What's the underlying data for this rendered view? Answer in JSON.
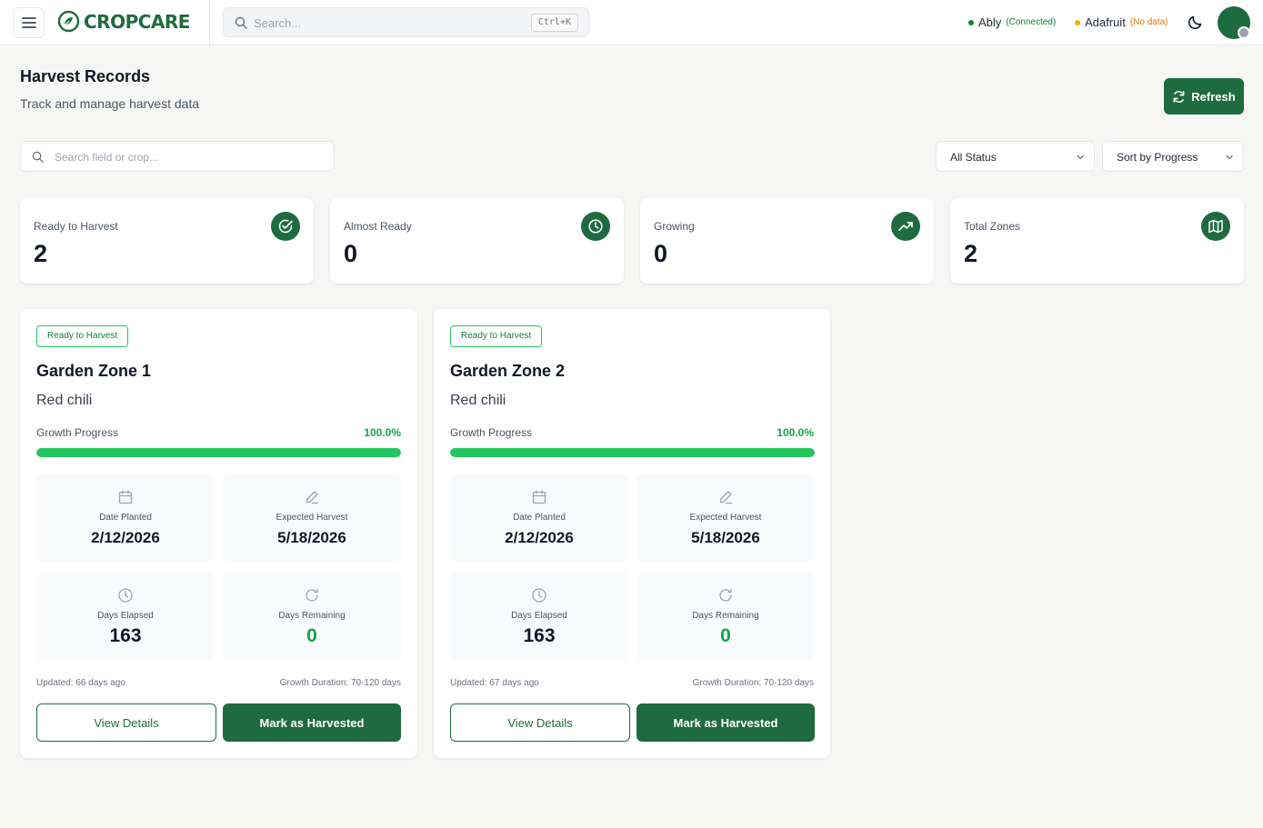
{
  "app": {
    "name": "CROPCARE"
  },
  "topbar": {
    "search_placeholder": "Search...",
    "shortcut": "Ctrl+K",
    "connections": [
      {
        "name": "Ably",
        "state": "(Connected)",
        "color": "#15803d"
      },
      {
        "name": "Adafruit",
        "state": "(No data)",
        "color": "#d97706"
      }
    ]
  },
  "header": {
    "title": "Harvest Records",
    "subtitle": "Track and manage harvest data",
    "refresh_label": "Refresh"
  },
  "filters": {
    "search_placeholder": "Search field or crop...",
    "status_value": "All Status",
    "sort_value": "Sort by Progress"
  },
  "stats": [
    {
      "label": "Ready to Harvest",
      "value": "2",
      "icon": "check-circle-icon"
    },
    {
      "label": "Almost Ready",
      "value": "0",
      "icon": "clock-icon"
    },
    {
      "label": "Growing",
      "value": "0",
      "icon": "trending-up-icon"
    },
    {
      "label": "Total Zones",
      "value": "2",
      "icon": "map-icon"
    }
  ],
  "zones": [
    {
      "status": "Ready to Harvest",
      "name": "Garden Zone 1",
      "crop": "Red chili",
      "progress_label": "Growth Progress",
      "progress_text": "100.0%",
      "progress": 1.0,
      "date_planted_label": "Date Planted",
      "date_planted": "2/12/2026",
      "expected_harvest_label": "Expected Harvest",
      "expected_harvest": "5/18/2026",
      "days_elapsed_label": "Days Elapsed",
      "days_elapsed": "163",
      "days_remaining_label": "Days Remaining",
      "days_remaining": "0",
      "updated": "Updated: 66 days ago",
      "duration": "Growth Duration: 70-120 days",
      "view_label": "View Details",
      "harvest_label": "Mark as Harvested"
    },
    {
      "status": "Ready to Harvest",
      "name": "Garden Zone 2",
      "crop": "Red chili",
      "progress_label": "Growth Progress",
      "progress_text": "100.0%",
      "progress": 1.0,
      "date_planted_label": "Date Planted",
      "date_planted": "2/12/2026",
      "expected_harvest_label": "Expected Harvest",
      "expected_harvest": "5/18/2026",
      "days_elapsed_label": "Days Elapsed",
      "days_elapsed": "163",
      "days_remaining_label": "Days Remaining",
      "days_remaining": "0",
      "updated": "Updated: 67 days ago",
      "duration": "Growth Duration: 70-120 days",
      "view_label": "View Details",
      "harvest_label": "Mark as Harvested"
    }
  ],
  "colors": {
    "brand": "#1f6b40",
    "success": "#22c55e"
  }
}
